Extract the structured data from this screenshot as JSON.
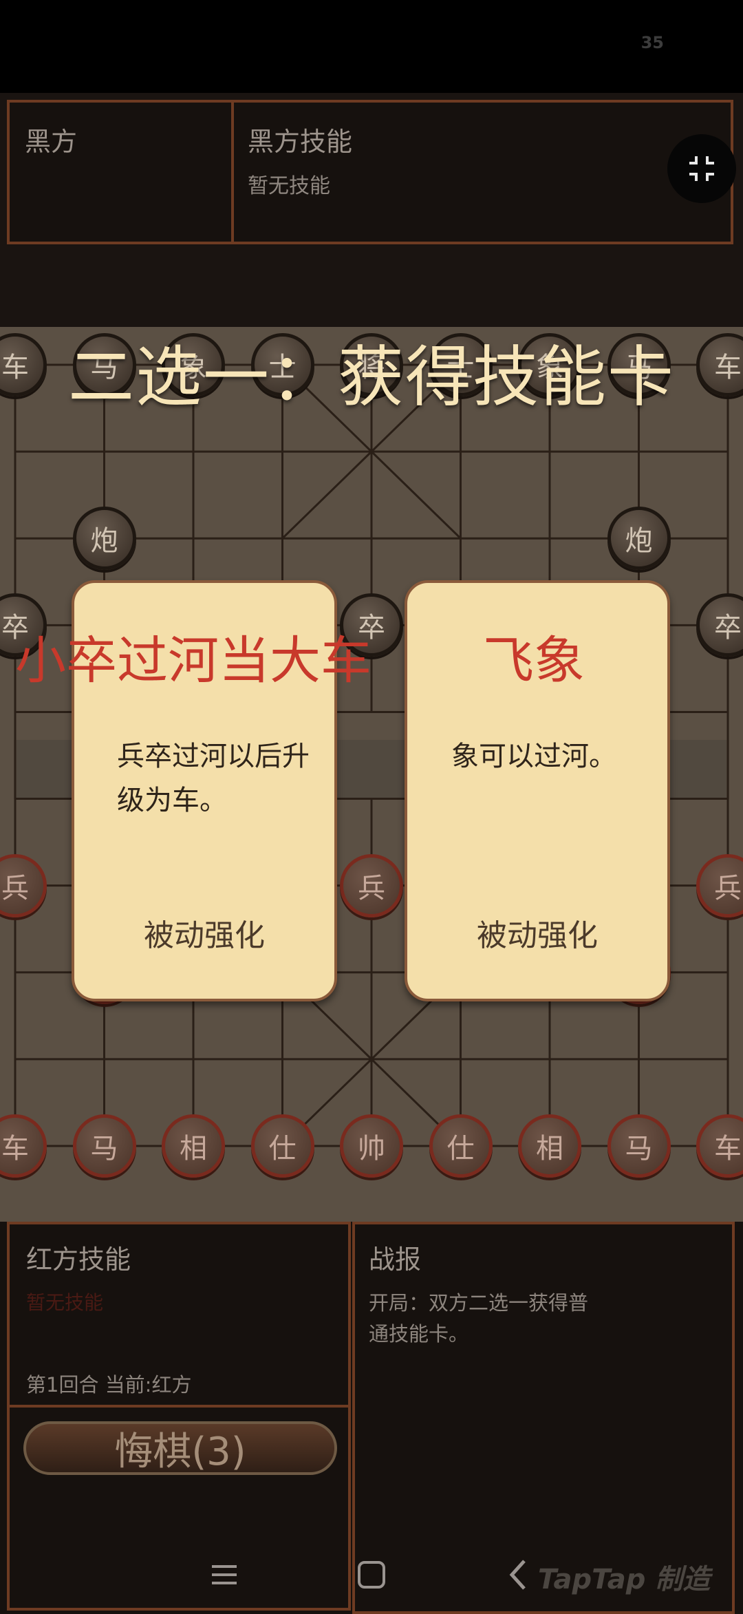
{
  "status_bar": {
    "number": "35"
  },
  "top_panel": {
    "black_side_label": "黑方",
    "black_skill_title": "黑方技能",
    "black_skill_value": "暂无技能"
  },
  "overlay": {
    "title": "二选一：获得技能卡"
  },
  "cards": [
    {
      "name": "小卒过河当大车",
      "description": "兵卒过河以后升级为车。",
      "tag": "被动强化"
    },
    {
      "name": "飞象",
      "description": "象可以过河。",
      "tag": "被动强化"
    }
  ],
  "pieces": {
    "black_top_row": [
      "车",
      "马",
      "象",
      "士",
      "将",
      "士",
      "象",
      "马",
      "车"
    ],
    "black_cannon": "炮",
    "black_soldier": "卒",
    "red_soldier": "兵",
    "red_bottom_row": [
      "车",
      "马",
      "相",
      "仕",
      "帅",
      "仕",
      "相",
      "马",
      "车"
    ]
  },
  "red_panel": {
    "skill_title": "红方技能",
    "skill_value": "暂无技能",
    "turn_info": "第1回合 当前:红方"
  },
  "undo_button": {
    "label": "悔棋(3)"
  },
  "report_panel": {
    "title": "战报",
    "text": "开局：双方二选一获得普通技能卡。"
  },
  "watermark": "TapTap 制造",
  "colors": {
    "accent_red": "#c8392b",
    "card_bg": "#f4dfaa",
    "border": "#6e3b22"
  }
}
